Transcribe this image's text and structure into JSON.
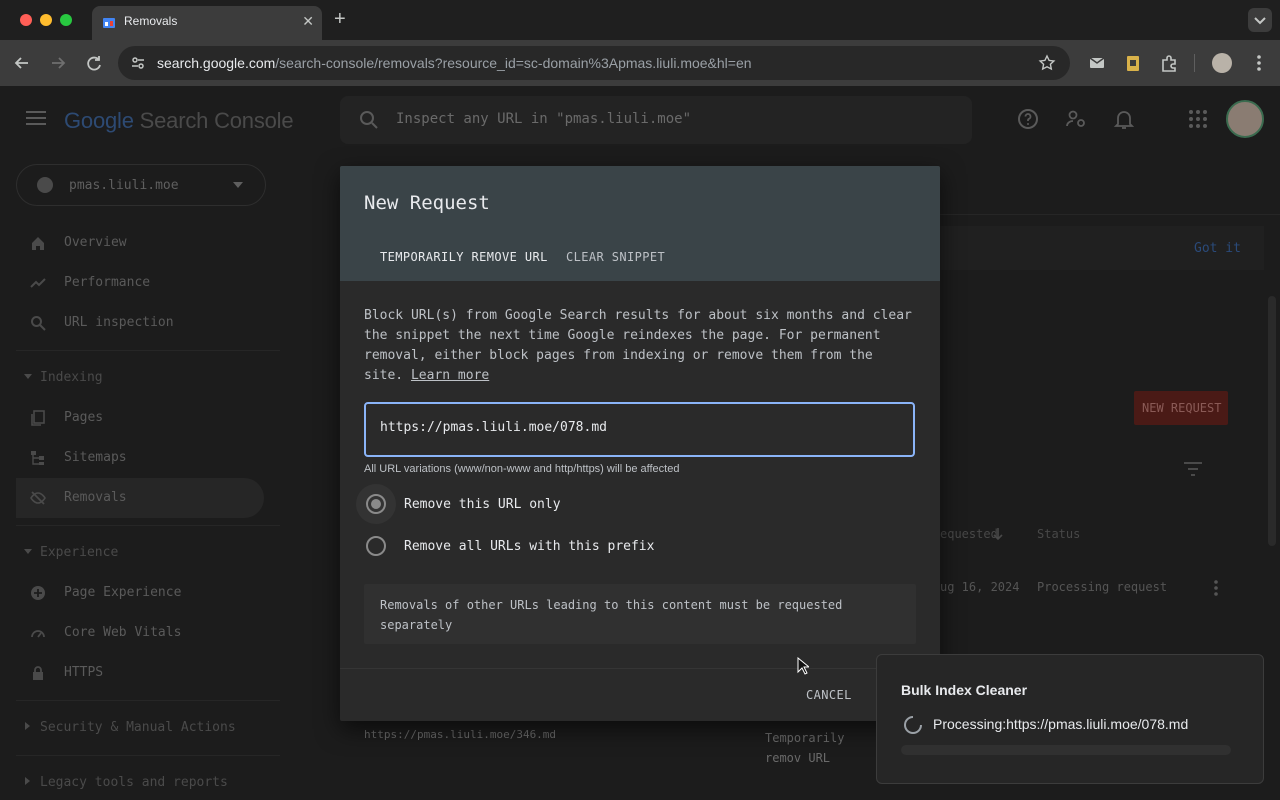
{
  "browser": {
    "tab_title": "Removals",
    "url_host": "search.google.com",
    "url_path": "/search-console/removals?resource_id=sc-domain%3Apmas.liuli.moe&hl=en"
  },
  "app": {
    "logo_google": "Google",
    "logo_product": " Search Console",
    "search_placeholder": "Inspect any URL in \"pmas.liuli.moe\"",
    "property": "pmas.liuli.moe"
  },
  "sidebar": {
    "items": [
      {
        "label": "Overview",
        "icon": "home-icon"
      },
      {
        "label": "Performance",
        "icon": "trending-icon"
      },
      {
        "label": "URL inspection",
        "icon": "search-icon"
      }
    ],
    "indexing": {
      "title": "Indexing",
      "items": [
        {
          "label": "Pages",
          "icon": "pages-icon"
        },
        {
          "label": "Sitemaps",
          "icon": "sitemap-icon"
        },
        {
          "label": "Removals",
          "icon": "visibility-off-icon"
        }
      ]
    },
    "experience": {
      "title": "Experience",
      "items": [
        {
          "label": "Page Experience",
          "icon": "plus-circle-icon"
        },
        {
          "label": "Core Web Vitals",
          "icon": "gauge-icon"
        },
        {
          "label": "HTTPS",
          "icon": "lock-icon"
        }
      ]
    },
    "security": "Security & Manual Actions",
    "legacy": "Legacy tools and reports"
  },
  "main": {
    "got_it": "Got it",
    "new_request": "NEW REQUEST",
    "col_requested": "equested",
    "col_status": "Status",
    "row1_date": "ug 16, 2024",
    "row1_status": "Processing request",
    "row2_url": "https://pmas.liuli.moe/346.md",
    "row2_type": "Temporarily remov URL"
  },
  "dialog": {
    "title": "New Request",
    "tab_active": "TEMPORARILY REMOVE URL",
    "tab_inactive": "CLEAR SNIPPET",
    "description": "Block URL(s) from Google Search results for about six months and clear the snippet the next time Google reindexes the page. For permanent removal, either block pages from indexing or remove them from the site.",
    "learn_more": "Learn more",
    "url_value": "https://pmas.liuli.moe/078.md",
    "hint": "All URL variations (www/non-www and http/https) will be affected",
    "radio_only": "Remove this URL only",
    "radio_prefix": "Remove all URLs with this prefix",
    "note": "Removals of other URLs leading to this content must be requested separately",
    "cancel": "CANCEL"
  },
  "popup": {
    "title": "Bulk Index Cleaner",
    "status": "Processing:https://pmas.liuli.moe/078.md",
    "progress": 0
  },
  "colors": {
    "accent_blue": "#8ab4f8",
    "dialog_header": "#3a4448",
    "new_request_red": "#4a1a16"
  }
}
